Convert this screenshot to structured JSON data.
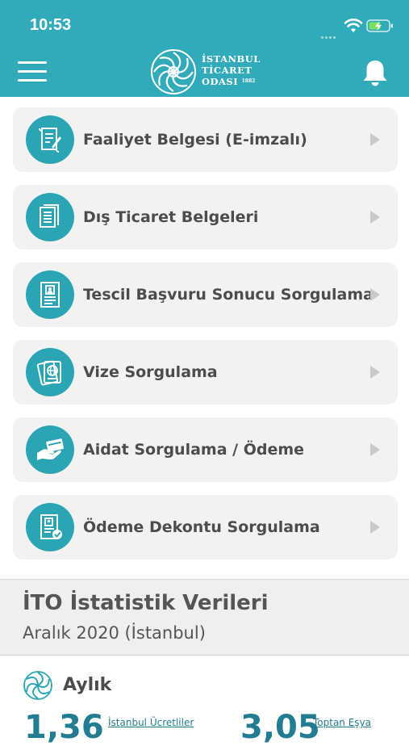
{
  "status_bar": {
    "time": "10:53"
  },
  "header": {
    "logo_line1": "İSTANBUL",
    "logo_line2": "TİCARET",
    "logo_line3": "ODASI",
    "logo_year": "1882"
  },
  "menu": [
    {
      "label": "Faaliyet Belgesi (E-imzalı)",
      "icon": "certificate-document-icon"
    },
    {
      "label": "Dış Ticaret Belgeleri",
      "icon": "documents-stack-icon"
    },
    {
      "label": "Tescil Başvuru Sonucu Sorgulama",
      "icon": "registration-form-icon"
    },
    {
      "label": "Vize Sorgulama",
      "icon": "passport-globe-icon"
    },
    {
      "label": "Aidat Sorgulama / Ödeme",
      "icon": "hand-card-payment-icon"
    },
    {
      "label": "Ödeme Dekontu Sorgulama",
      "icon": "receipt-check-icon"
    }
  ],
  "stats": {
    "title": "İTO İstatistik Verileri",
    "subtitle": "Aralık 2020 (İstanbul)",
    "period_label": "Aylık",
    "items": [
      {
        "value": "1,36",
        "caption": "İstanbul Ücretliler"
      },
      {
        "value": "3,05",
        "caption": "Toptan Eşya"
      }
    ]
  },
  "colors": {
    "brand_teal": "#31aab9",
    "icon_teal": "#2ba5b4",
    "card_bg": "#f2f2f2",
    "stat_blue": "#237d92"
  }
}
